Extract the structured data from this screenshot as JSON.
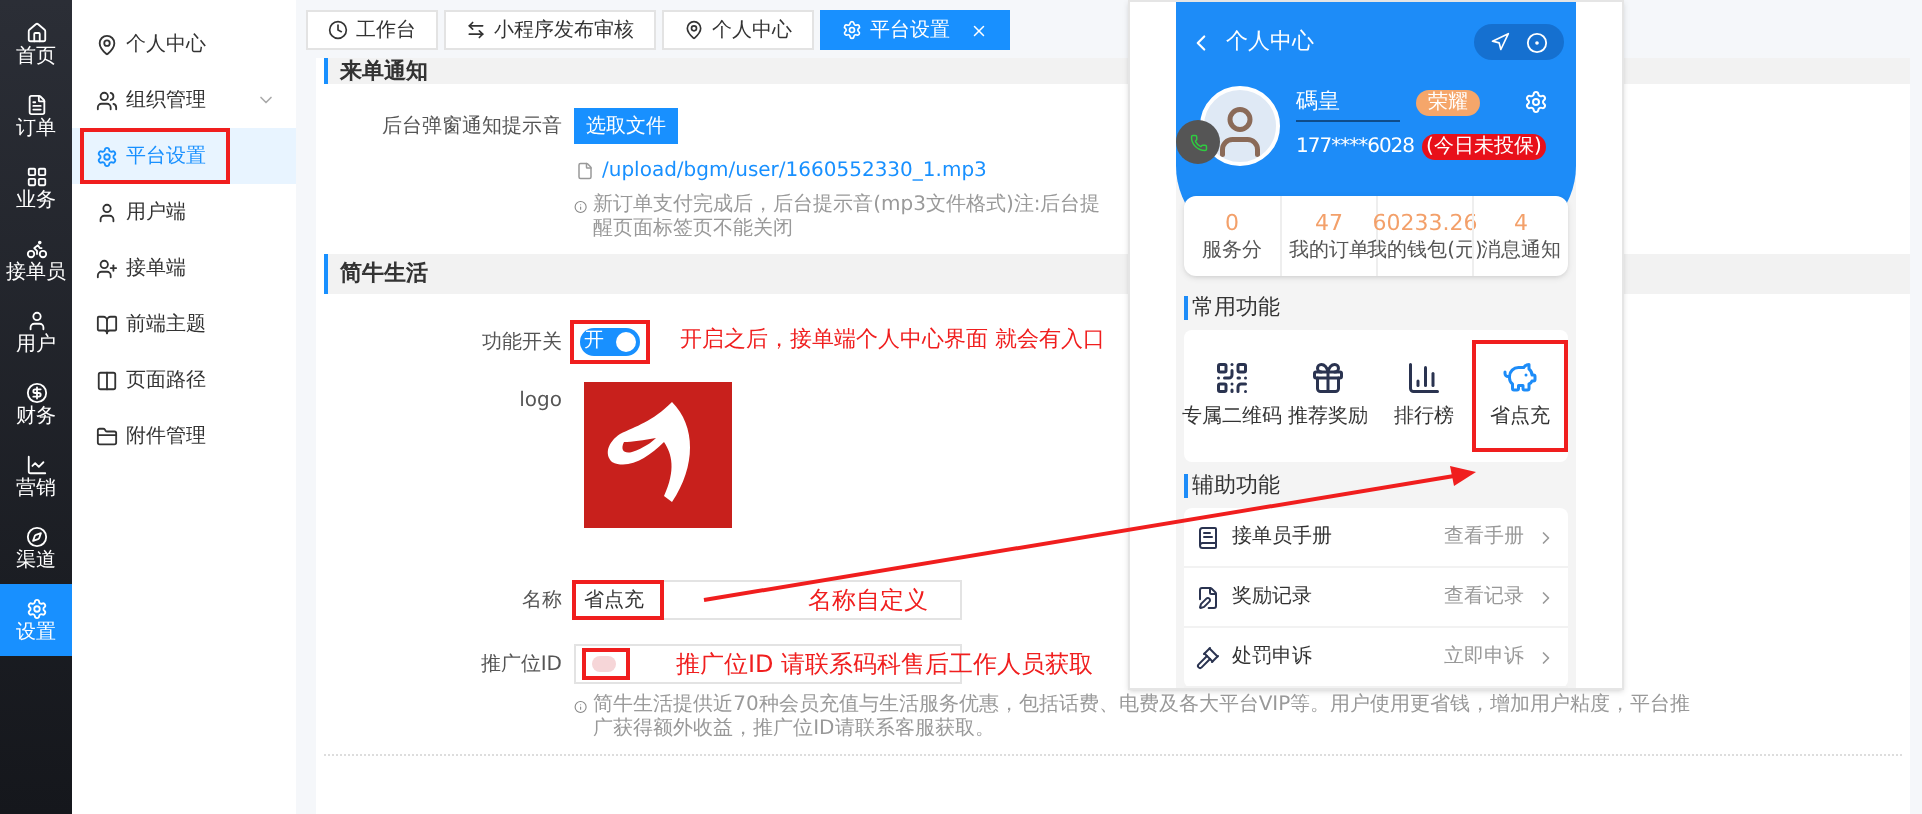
{
  "rail": [
    {
      "label": "首页",
      "selected": false
    },
    {
      "label": "订单",
      "selected": false
    },
    {
      "label": "业务",
      "selected": false
    },
    {
      "label": "接单员",
      "selected": false
    },
    {
      "label": "用户",
      "selected": false
    },
    {
      "label": "财务",
      "selected": false
    },
    {
      "label": "营销",
      "selected": false
    },
    {
      "label": "渠道",
      "selected": false
    },
    {
      "label": "设置",
      "selected": true
    }
  ],
  "menu": {
    "items": [
      {
        "label": "个人中心",
        "selected": false,
        "expandable": false,
        "highlighted": false
      },
      {
        "label": "组织管理",
        "selected": false,
        "expandable": true,
        "highlighted": false
      },
      {
        "label": "平台设置",
        "selected": true,
        "expandable": false,
        "highlighted": true
      },
      {
        "label": "用户端",
        "selected": false,
        "expandable": false,
        "highlighted": false
      },
      {
        "label": "接单端",
        "selected": false,
        "expandable": false,
        "highlighted": false
      },
      {
        "label": "前端主题",
        "selected": false,
        "expandable": false,
        "highlighted": false
      },
      {
        "label": "页面路径",
        "selected": false,
        "expandable": false,
        "highlighted": false
      },
      {
        "label": "附件管理",
        "selected": false,
        "expandable": false,
        "highlighted": false
      }
    ]
  },
  "tabs": [
    {
      "label": "工作台",
      "selected": false,
      "closable": false
    },
    {
      "label": "小程序发布审核",
      "selected": false,
      "closable": false
    },
    {
      "label": "个人中心",
      "selected": false,
      "closable": false
    },
    {
      "label": "平台设置",
      "selected": true,
      "closable": true
    }
  ],
  "notice_section": {
    "title": "来单通知",
    "field_label": "后台弹窗通知提示音",
    "button": "选取文件",
    "file": "/upload/bgm/user/1660552330_1.mp3",
    "hint": "新订单支付完成后，后台提示音(mp3文件格式)注:后台提醒页面标签页不能关闭"
  },
  "life_section": {
    "title": "简牛生活",
    "switch": {
      "label": "功能开关",
      "on": true,
      "text": "开",
      "highlighted": true,
      "note": "开启之后，接单端个人中心界面 就会有入口"
    },
    "logo_label": "logo",
    "name": {
      "label": "名称",
      "value": "省点充",
      "highlighted": true,
      "note": "名称自定义"
    },
    "ad_id": {
      "label": "推广位ID",
      "highlighted": true,
      "note": "推广位ID 请联系码科售后工作人员获取"
    },
    "hint": "简牛生活提供近70种会员充值与生活服务优惠，包括话费、电费及各大平台VIP等。用户使用更省钱，增加用户粘度，平台推广获得额外收益，推广位ID请联系客服获取。"
  },
  "phone": {
    "title": "个人中心",
    "user_name": "碼皇",
    "badge": "荣耀",
    "phone": "177****6028",
    "tag": "(今日未投保)",
    "stats": [
      {
        "value": "0",
        "label": "服务分"
      },
      {
        "value": "47",
        "label": "我的订单"
      },
      {
        "value": "60233.26",
        "label": "我的钱包(元)"
      },
      {
        "value": "4",
        "label": "消息通知"
      }
    ],
    "common_title": "常用功能",
    "common": [
      {
        "label": "专属二维码",
        "highlighted": false
      },
      {
        "label": "推荐奖励",
        "highlighted": false
      },
      {
        "label": "排行榜",
        "highlighted": false
      },
      {
        "label": "省点充",
        "highlighted": true
      }
    ],
    "aux_title": "辅助功能",
    "aux": [
      {
        "label": "接单员手册",
        "action": "查看手册"
      },
      {
        "label": "奖励记录",
        "action": "查看记录"
      },
      {
        "label": "处罚申诉",
        "action": "立即申诉"
      }
    ]
  }
}
